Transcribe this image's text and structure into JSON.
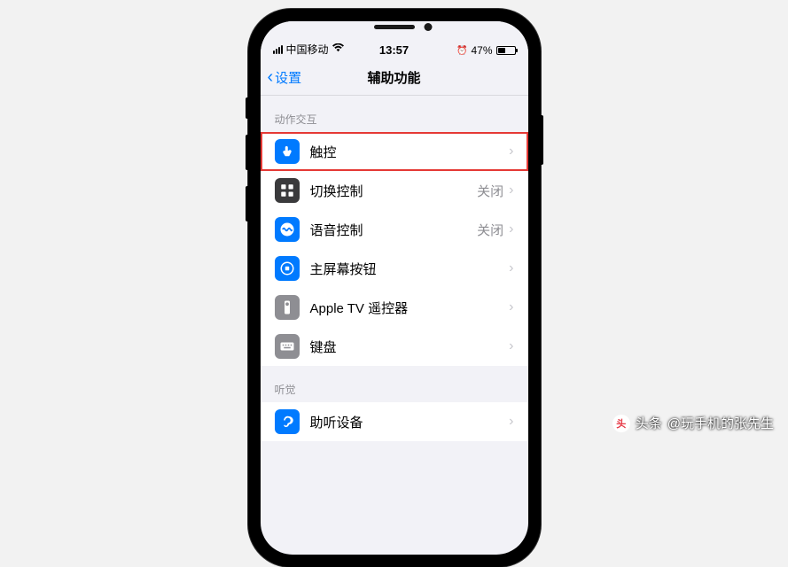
{
  "status": {
    "carrier": "中国移动",
    "time": "13:57",
    "battery_pct": "47%",
    "battery_fill": 47
  },
  "nav": {
    "back_label": "设置",
    "title": "辅助功能"
  },
  "sections": [
    {
      "header": "动作交互",
      "items": [
        {
          "label": "触控",
          "value": "",
          "icon": "touch-icon",
          "color": "icon-blue",
          "highlight": true
        },
        {
          "label": "切换控制",
          "value": "关闭",
          "icon": "switch-control-icon",
          "color": "icon-dark",
          "highlight": false
        },
        {
          "label": "语音控制",
          "value": "关闭",
          "icon": "voice-control-icon",
          "color": "icon-blue",
          "highlight": false
        },
        {
          "label": "主屏幕按钮",
          "value": "",
          "icon": "home-button-icon",
          "color": "icon-blue",
          "highlight": false
        },
        {
          "label": "Apple TV 遥控器",
          "value": "",
          "icon": "appletv-remote-icon",
          "color": "icon-gray",
          "highlight": false
        },
        {
          "label": "键盘",
          "value": "",
          "icon": "keyboard-icon",
          "color": "icon-gray",
          "highlight": false
        }
      ]
    },
    {
      "header": "听觉",
      "items": [
        {
          "label": "助听设备",
          "value": "",
          "icon": "hearing-icon",
          "color": "icon-blue",
          "highlight": false
        }
      ]
    }
  ],
  "watermark": {
    "prefix": "头条",
    "handle": "@玩手机的张先生"
  }
}
